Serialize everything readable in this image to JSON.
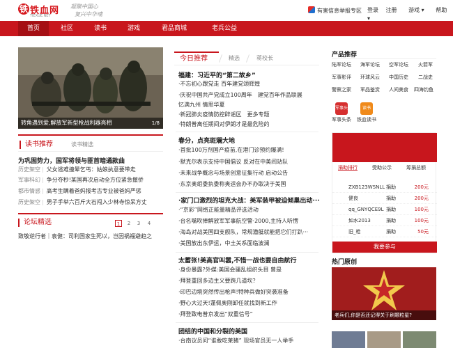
{
  "header": {
    "logo_text": "铁血网",
    "logo_domain": "TIEXUE.NET",
    "slogan_line1": "凝聚中国心",
    "slogan_line2": "复兴中华魂",
    "report_link": "有害信息举报专区",
    "links": [
      "登录",
      "注册",
      "游戏 ▾",
      "帮助 ▾"
    ]
  },
  "nav": {
    "items": [
      {
        "label": "首页",
        "active": true
      },
      {
        "label": "社区",
        "active": false
      },
      {
        "label": "读书",
        "active": false
      },
      {
        "label": "游戏",
        "active": false
      },
      {
        "label": "君品商城",
        "active": false
      },
      {
        "label": "老兵公益",
        "active": false
      }
    ]
  },
  "hero": {
    "caption": "转角遇到爱,解放军新型枪战利器亮相",
    "counter": "1/8"
  },
  "reading": {
    "tab_active": "读书推荐",
    "tab_other": "读书精选",
    "headline": "为巩固势力，国军将领与匪首暗通款曲",
    "rows": [
      {
        "cat": "历史架空",
        "title": "父女逃难撞晕乞丐：姑娘执意要带走"
      },
      {
        "cat": "军事科幻",
        "title": "争分夺秒!某国再次启动全方位紧急撤侨"
      },
      {
        "cat": "都市情感",
        "title": "高考生瞒着爸妈报考古专业被爸妈严惩"
      },
      {
        "cat": "历史架空",
        "title": "男子手举六百斤大石闯入少林寺惊呆方丈"
      }
    ]
  },
  "forum": {
    "tab": "论坛精选",
    "pages": [
      "1",
      "2",
      "3",
      "4"
    ],
    "line": "致敬逆行者｜袁健：司利国家生死以，岂因祸福避趋之"
  },
  "middle": {
    "tabs": [
      "今日推荐",
      "精选",
      "蒋校长"
    ],
    "groups": [
      {
        "title": "福建：习近平的“第二故乡”",
        "lines": [
          [
            "·不忘初心跟党走 百年建党颂辉煌"
          ],
          [
            "·庆祝中国共产党成立100周年",
            "建党百年作品联展"
          ],
          [
            "忆满九州 情思华夏"
          ],
          [
            "·新冠肺炎疫情防控辟谣区",
            "更多专题"
          ],
          [
            "·特朗普离任期间对伊朗才是最危险的"
          ]
        ]
      },
      {
        "title": "春分，点亮斑斓大地",
        "lines": [
          [
            "·首批100万剂国产疫苗,在港门诊预约爆满!"
          ],
          [
            "·默克尔表示支持中国倡议 反对在中美间站队"
          ],
          [
            "·未来战争概念与场景创意征集行动 启动公告"
          ],
          [
            "·东京奥组委执委称奥运会办不办取决于美国"
          ]
        ]
      },
      {
        "title": "·家门口激烈的坦克大战：美军装甲被迫倾巢出动···",
        "lines": [
          [
            "·“京彩”网络正能量精品评选活动"
          ],
          [
            "·台名嘴吹捧解放军军事航空警·2000,主持人听愣"
          ],
          [
            "·海岛对战美国四支舰队，常规潜艇就能把它们打趴···"
          ],
          [
            "·美国放出东伊运，中土关系面临波澜"
          ]
        ]
      },
      {
        "title": "太蓄张!美高官叫嚣,不惜一战也要自由航行",
        "lines": [
          [
            "·身份暴露?外媒:美国会骚乱组织头目 曾是"
          ],
          [
            "·拜登重回多边主义要跨几道坎？"
          ],
          [
            "·印巴边境突然传出枪声!特种兵做好突袭准备"
          ],
          [
            "·野心大过天!蓬佩奥刚卸任就找到新工作"
          ],
          [
            "·拜登致电普京发出“双重信号”"
          ]
        ]
      },
      {
        "title": "团结的中国和分裂的美国",
        "lines": [
          [
            "·台南议员问“谁敢吃莱猪” 现场官员无一人举手"
          ]
        ]
      }
    ]
  },
  "products": {
    "title": "产品推荐",
    "rows": [
      [
        "陆军论坛",
        "海军论坛",
        "空军论坛",
        "火箭军"
      ],
      [
        "军事影评",
        "环球风云",
        "中国历史",
        "二战史"
      ],
      [
        "警察之家",
        "军品鉴赏",
        "人间美食",
        "四海钓鱼"
      ]
    ],
    "apps": [
      {
        "label": "军事头条",
        "icon": "军事头条",
        "color": "#d62f2f"
      },
      {
        "label": "铁血读书",
        "icon": "读书",
        "color": "#f08a1a"
      }
    ]
  },
  "ranking": {
    "tabs": [
      "捐助排行",
      "受助公示",
      "筹捐总额"
    ],
    "rows": [
      {
        "name": "ZXB123WSNLL",
        "type": "捐助",
        "amount": "200元"
      },
      {
        "name": "健良",
        "type": "捐助",
        "amount": "200元"
      },
      {
        "name": "qq_GNYQCE9L",
        "type": "捐助",
        "amount": "100元"
      },
      {
        "name": "如水2013",
        "type": "捐助",
        "amount": "100元"
      },
      {
        "name": "旧_枪",
        "type": "捐助",
        "amount": "50元"
      }
    ],
    "join": "我要参与"
  },
  "hot": {
    "title": "热门原创",
    "caption": "老兵们,你是否还记得关于刷颗粒星?"
  },
  "colors": {
    "brand_red": "#c8161d",
    "nav_active": "#a50f14"
  }
}
